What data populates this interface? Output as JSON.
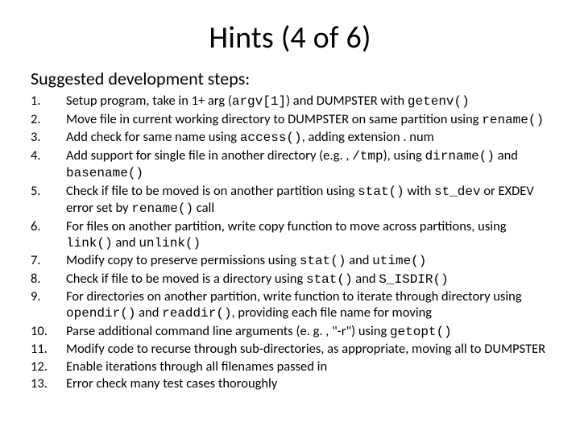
{
  "title": "Hints (4 of 6)",
  "subhead": "Suggested development steps:",
  "steps": [
    [
      {
        "t": "Setup program, take in 1+ arg ("
      },
      {
        "t": "argv[1]",
        "c": true
      },
      {
        "t": ") and DUMPSTER with "
      },
      {
        "t": "getenv()",
        "c": true
      }
    ],
    [
      {
        "t": "Move file in current working directory to DUMPSTER on same partition using "
      },
      {
        "t": "rename()",
        "c": true
      }
    ],
    [
      {
        "t": "Add check for same name using "
      },
      {
        "t": "access()",
        "c": true
      },
      {
        "t": ", adding extension . num"
      }
    ],
    [
      {
        "t": "Add support for single file in another directory (e.g. , "
      },
      {
        "t": "/tmp",
        "c": true
      },
      {
        "t": "), using "
      },
      {
        "t": "dirname()",
        "c": true
      },
      {
        "t": " and "
      },
      {
        "t": "basename()",
        "c": true
      }
    ],
    [
      {
        "t": "Check if file to be moved is on another partition using "
      },
      {
        "t": "stat()",
        "c": true
      },
      {
        "t": " with "
      },
      {
        "t": "st_dev",
        "c": true
      },
      {
        "t": "  or EXDEV error set by "
      },
      {
        "t": "rename()",
        "c": true
      },
      {
        "t": " call"
      }
    ],
    [
      {
        "t": "For files on another partition, write copy function to move across partitions, using "
      },
      {
        "t": "link()",
        "c": true
      },
      {
        "t": " and "
      },
      {
        "t": "unlink()",
        "c": true
      }
    ],
    [
      {
        "t": "Modify copy to preserve permissions using "
      },
      {
        "t": "stat()",
        "c": true
      },
      {
        "t": " and "
      },
      {
        "t": "utime()",
        "c": true
      }
    ],
    [
      {
        "t": "Check if file to be moved is a directory using "
      },
      {
        "t": "stat()",
        "c": true
      },
      {
        "t": " and "
      },
      {
        "t": "S_ISDIR()",
        "c": true
      }
    ],
    [
      {
        "t": "For directories on another partition, write function to iterate through directory using "
      },
      {
        "t": "opendir()",
        "c": true
      },
      {
        "t": " and "
      },
      {
        "t": "readdir()",
        "c": true
      },
      {
        "t": ", providing each file name for moving"
      }
    ],
    [
      {
        "t": "Parse additional command line arguments (e. g. , \"-r\") using "
      },
      {
        "t": "getopt()",
        "c": true
      }
    ],
    [
      {
        "t": "Modify code to recurse through sub-directories, as appropriate, moving all to DUMPSTER"
      }
    ],
    [
      {
        "t": "Enable iterations through all filenames passed in"
      }
    ],
    [
      {
        "t": "Error check many test cases thoroughly"
      }
    ]
  ]
}
